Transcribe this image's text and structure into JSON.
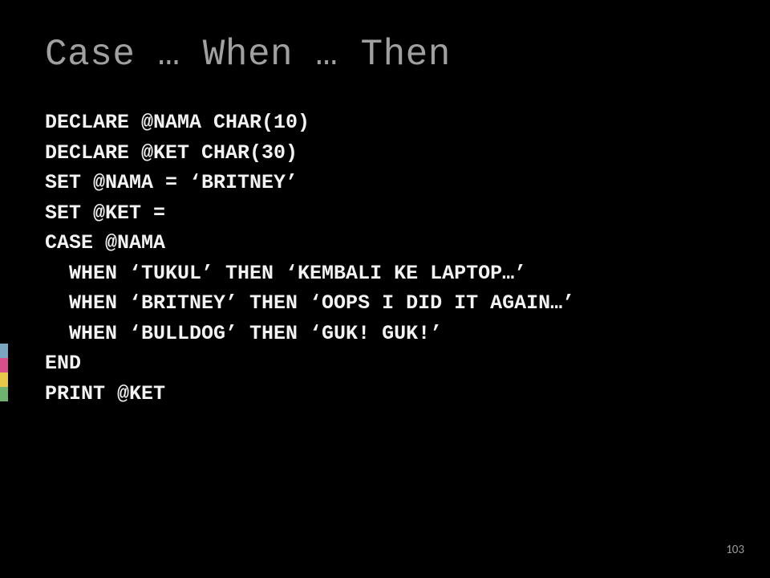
{
  "slide": {
    "title": "Case … When … Then",
    "code": {
      "l1": "DECLARE @NAMA CHAR(10)",
      "l2": "DECLARE @KET CHAR(30)",
      "l3": "SET @NAMA = ‘BRITNEY’",
      "l4": "SET @KET =",
      "l5": "CASE @NAMA",
      "l6": "  WHEN ‘TUKUL’ THEN ‘KEMBALI KE LAPTOP…’",
      "l7": "  WHEN ‘BRITNEY’ THEN ‘OOPS I DID IT AGAIN…’",
      "l8": "  WHEN ‘BULLDOG’ THEN ‘GUK! GUK!’",
      "l9": "END",
      "l10": "PRINT @KET"
    },
    "page_number": "103"
  }
}
